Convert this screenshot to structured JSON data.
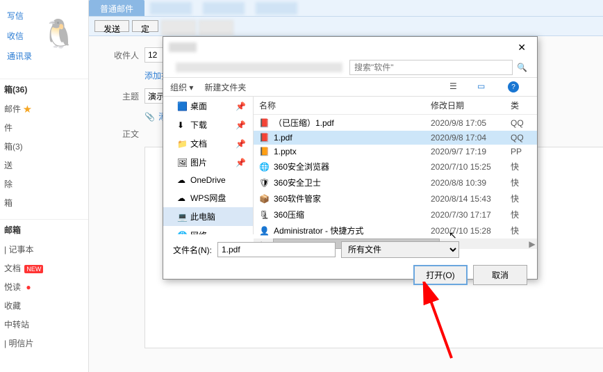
{
  "sidebar": {
    "nav": [
      "写信",
      "收信",
      "通讯录"
    ],
    "inbox_count": "箱(36)",
    "folders": [
      {
        "label": "邮件",
        "star": true
      },
      {
        "label": "件"
      },
      {
        "label": "箱(3)"
      },
      {
        "label": "送"
      },
      {
        "label": "除"
      },
      {
        "label": "箱"
      }
    ],
    "group2_title": "邮箱",
    "group3": [
      {
        "label": "| 记事本"
      },
      {
        "label": "文档",
        "new": "NEW"
      },
      {
        "label": "悦读",
        "dot": true
      },
      {
        "label": "收藏"
      },
      {
        "label": "中转站"
      },
      {
        "label": "| 明信片"
      }
    ]
  },
  "tabs": {
    "active": "普通邮件"
  },
  "toolbar": {
    "send": "发送",
    "schedule": "定"
  },
  "compose": {
    "recipient_label": "收件人",
    "recipient_value": "12",
    "add_cc": "添加抄送",
    "subject_label": "主题",
    "subject_value": "演示",
    "attach_text": "添加",
    "body_label": "正文"
  },
  "dialog": {
    "search_placeholder": "搜索\"软件\"",
    "toolbar": {
      "organize": "组织 ▾",
      "newfolder": "新建文件夹"
    },
    "tree": [
      {
        "icon": "🟦",
        "label": "桌面",
        "pinned": true
      },
      {
        "icon": "⬇",
        "label": "下载",
        "pinned": true
      },
      {
        "icon": "📁",
        "label": "文档",
        "pinned": true
      },
      {
        "icon": "🖼",
        "label": "图片",
        "pinned": true
      },
      {
        "icon": "☁",
        "label": "OneDrive"
      },
      {
        "icon": "☁",
        "label": "WPS网盘"
      },
      {
        "icon": "💻",
        "label": "此电脑",
        "selected": true
      },
      {
        "icon": "🌐",
        "label": "网络"
      }
    ],
    "cols": {
      "name": "名称",
      "date": "修改日期",
      "type": "类"
    },
    "files": [
      {
        "icon": "📕",
        "name": "（已压缩）1.pdf",
        "date": "2020/9/8 17:05",
        "type": "QQ"
      },
      {
        "icon": "📕",
        "name": "1.pdf",
        "date": "2020/9/8 17:04",
        "type": "QQ",
        "selected": true
      },
      {
        "icon": "📙",
        "name": "1.pptx",
        "date": "2020/9/7 17:19",
        "type": "PP"
      },
      {
        "icon": "🌐",
        "name": "360安全浏览器",
        "date": "2020/7/10 15:25",
        "type": "快"
      },
      {
        "icon": "🛡",
        "name": "360安全卫士",
        "date": "2020/8/8 10:39",
        "type": "快"
      },
      {
        "icon": "📦",
        "name": "360软件管家",
        "date": "2020/8/14 15:43",
        "type": "快"
      },
      {
        "icon": "🗜",
        "name": "360压缩",
        "date": "2020/7/30 17:17",
        "type": "快"
      },
      {
        "icon": "👤",
        "name": "Administrator - 快捷方式",
        "date": "2020/7/10 15:28",
        "type": "快"
      }
    ],
    "filename_label": "文件名(N):",
    "filename_value": "1.pdf",
    "filter": "所有文件",
    "open_btn": "打开(O)",
    "cancel_btn": "取消"
  }
}
